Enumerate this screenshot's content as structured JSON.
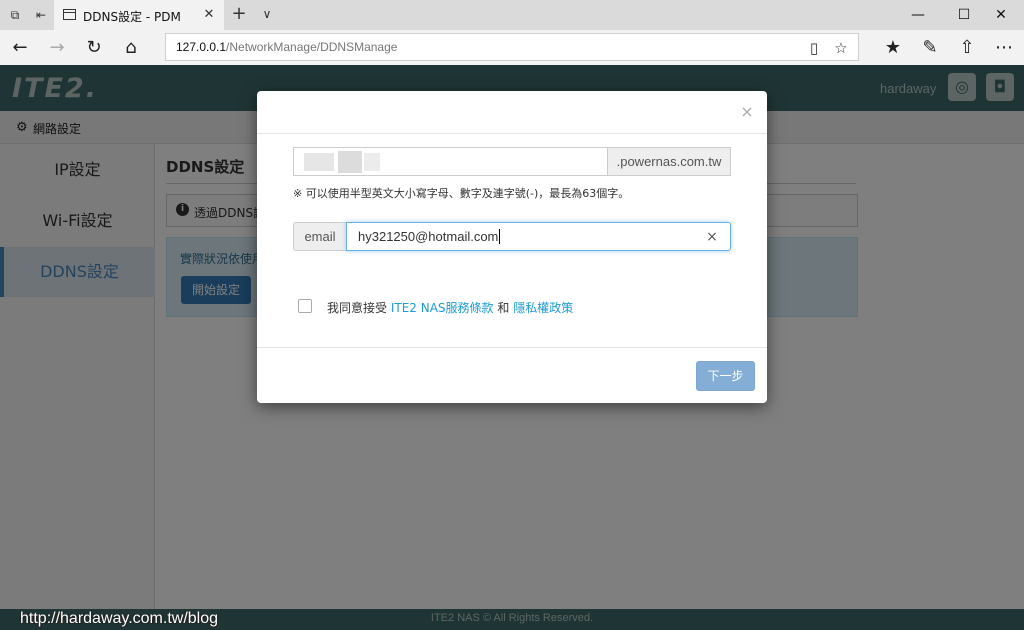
{
  "browser": {
    "tab_title": "DDNS設定 - PDM",
    "url_host": "127.0.0.1",
    "url_path": "/NetworkManage/DDNSManage"
  },
  "header": {
    "logo": "ITE2.",
    "username": "hardaway"
  },
  "breadcrumb": {
    "label": "網路設定"
  },
  "sidebar": {
    "items": [
      {
        "label": "IP設定"
      },
      {
        "label": "Wi-Fi設定"
      },
      {
        "label": "DDNS設定"
      }
    ]
  },
  "content": {
    "title": "DDNS設定",
    "info_text": "透過DDNS讓",
    "panel_text": "實際狀況依使用",
    "start_button": "開始設定"
  },
  "modal": {
    "domain_suffix": ".powernas.com.tw",
    "hint": "※ 可以使用半型英文大小寫字母、數字及連字號(-)，最長為63個字。",
    "email_label": "email",
    "email_value": "hy321250@hotmail.com",
    "agree_prefix": "我同意接受",
    "terms_link": "ITE2 NAS服務條款",
    "agree_and": "和",
    "privacy_link": "隱私權政策",
    "next_button": "下一步"
  },
  "footer": {
    "copyright": "ITE2 NAS © All Rights Reserved."
  },
  "watermark": "http://hardaway.com.tw/blog",
  "colors": {
    "header_bg": "#3f6b6b",
    "active_accent": "#4a86b8",
    "link": "#1f9bd1",
    "primary_button": "#84aed6"
  }
}
